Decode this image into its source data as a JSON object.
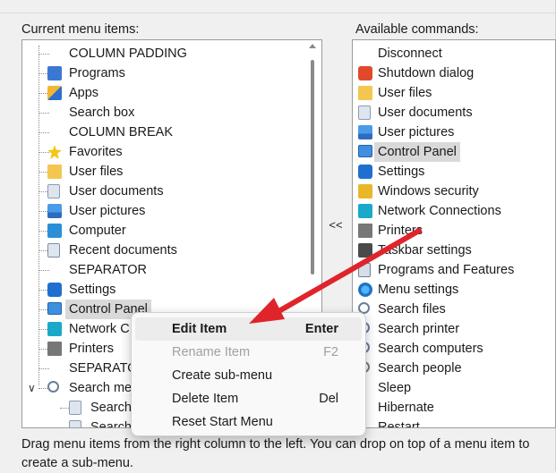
{
  "left_caption": "Current menu items:",
  "right_caption": "Available commands:",
  "move_button_label": "<<",
  "status_text": "Drag menu items from the right column to the left. You can drop on top of a menu item to create a sub-menu.",
  "left_items": [
    {
      "label": "COLUMN PADDING",
      "icon": "none"
    },
    {
      "label": "Programs",
      "icon": "programs-icon"
    },
    {
      "label": "Apps",
      "icon": "apps-icon"
    },
    {
      "label": "Search box",
      "icon": "none"
    },
    {
      "label": "COLUMN BREAK",
      "icon": "none"
    },
    {
      "label": "Favorites",
      "icon": "star-icon"
    },
    {
      "label": "User files",
      "icon": "folder-icon"
    },
    {
      "label": "User documents",
      "icon": "document-icon"
    },
    {
      "label": "User pictures",
      "icon": "pictures-icon"
    },
    {
      "label": "Computer",
      "icon": "computer-icon"
    },
    {
      "label": "Recent documents",
      "icon": "recent-documents-icon"
    },
    {
      "label": "SEPARATOR",
      "icon": "none"
    },
    {
      "label": "Settings",
      "icon": "settings-gear-icon"
    },
    {
      "label": "Control Panel",
      "icon": "control-panel-icon",
      "selected": true
    },
    {
      "label": "Network C",
      "icon": "network-icon"
    },
    {
      "label": "Printers",
      "icon": "printer-icon"
    },
    {
      "label": "SEPARATO",
      "icon": "none"
    },
    {
      "label": "Search me",
      "icon": "search-icon"
    },
    {
      "label": "Search",
      "icon": "document-icon"
    },
    {
      "label": "Search",
      "icon": "document-icon"
    }
  ],
  "right_items": [
    {
      "label": "Disconnect",
      "icon": "none"
    },
    {
      "label": "Shutdown dialog",
      "icon": "shutdown-icon"
    },
    {
      "label": "User files",
      "icon": "folder-icon"
    },
    {
      "label": "User documents",
      "icon": "document-icon"
    },
    {
      "label": "User pictures",
      "icon": "pictures-icon"
    },
    {
      "label": "Control Panel",
      "icon": "control-panel-icon",
      "selected": true
    },
    {
      "label": "Settings",
      "icon": "settings-gear-icon"
    },
    {
      "label": "Windows security",
      "icon": "lock-icon"
    },
    {
      "label": "Network Connections",
      "icon": "network-icon"
    },
    {
      "label": "Printers",
      "icon": "printer-icon"
    },
    {
      "label": "Taskbar settings",
      "icon": "taskbar-icon"
    },
    {
      "label": "Programs and Features",
      "icon": "programs-features-icon"
    },
    {
      "label": "Menu settings",
      "icon": "menu-settings-icon"
    },
    {
      "label": "Search files",
      "icon": "search-icon"
    },
    {
      "label": "Search printer",
      "icon": "search-icon"
    },
    {
      "label": "Search computers",
      "icon": "search-icon"
    },
    {
      "label": "Search people",
      "icon": "search-icon"
    },
    {
      "label": "Sleep",
      "icon": "none"
    },
    {
      "label": "Hibernate",
      "icon": "none"
    },
    {
      "label": "Restart",
      "icon": "none"
    }
  ],
  "context_menu": [
    {
      "label": "Edit Item",
      "shortcut": "Enter",
      "highlighted": true
    },
    {
      "label": "Rename Item",
      "shortcut": "F2",
      "disabled": true
    },
    {
      "label": "Create sub-menu",
      "shortcut": ""
    },
    {
      "label": "Delete Item",
      "shortcut": "Del"
    },
    {
      "label": "Reset Start Menu",
      "shortcut": ""
    }
  ],
  "colors": {
    "arrow": "#e0242b",
    "selection": "#d9d9d9"
  }
}
